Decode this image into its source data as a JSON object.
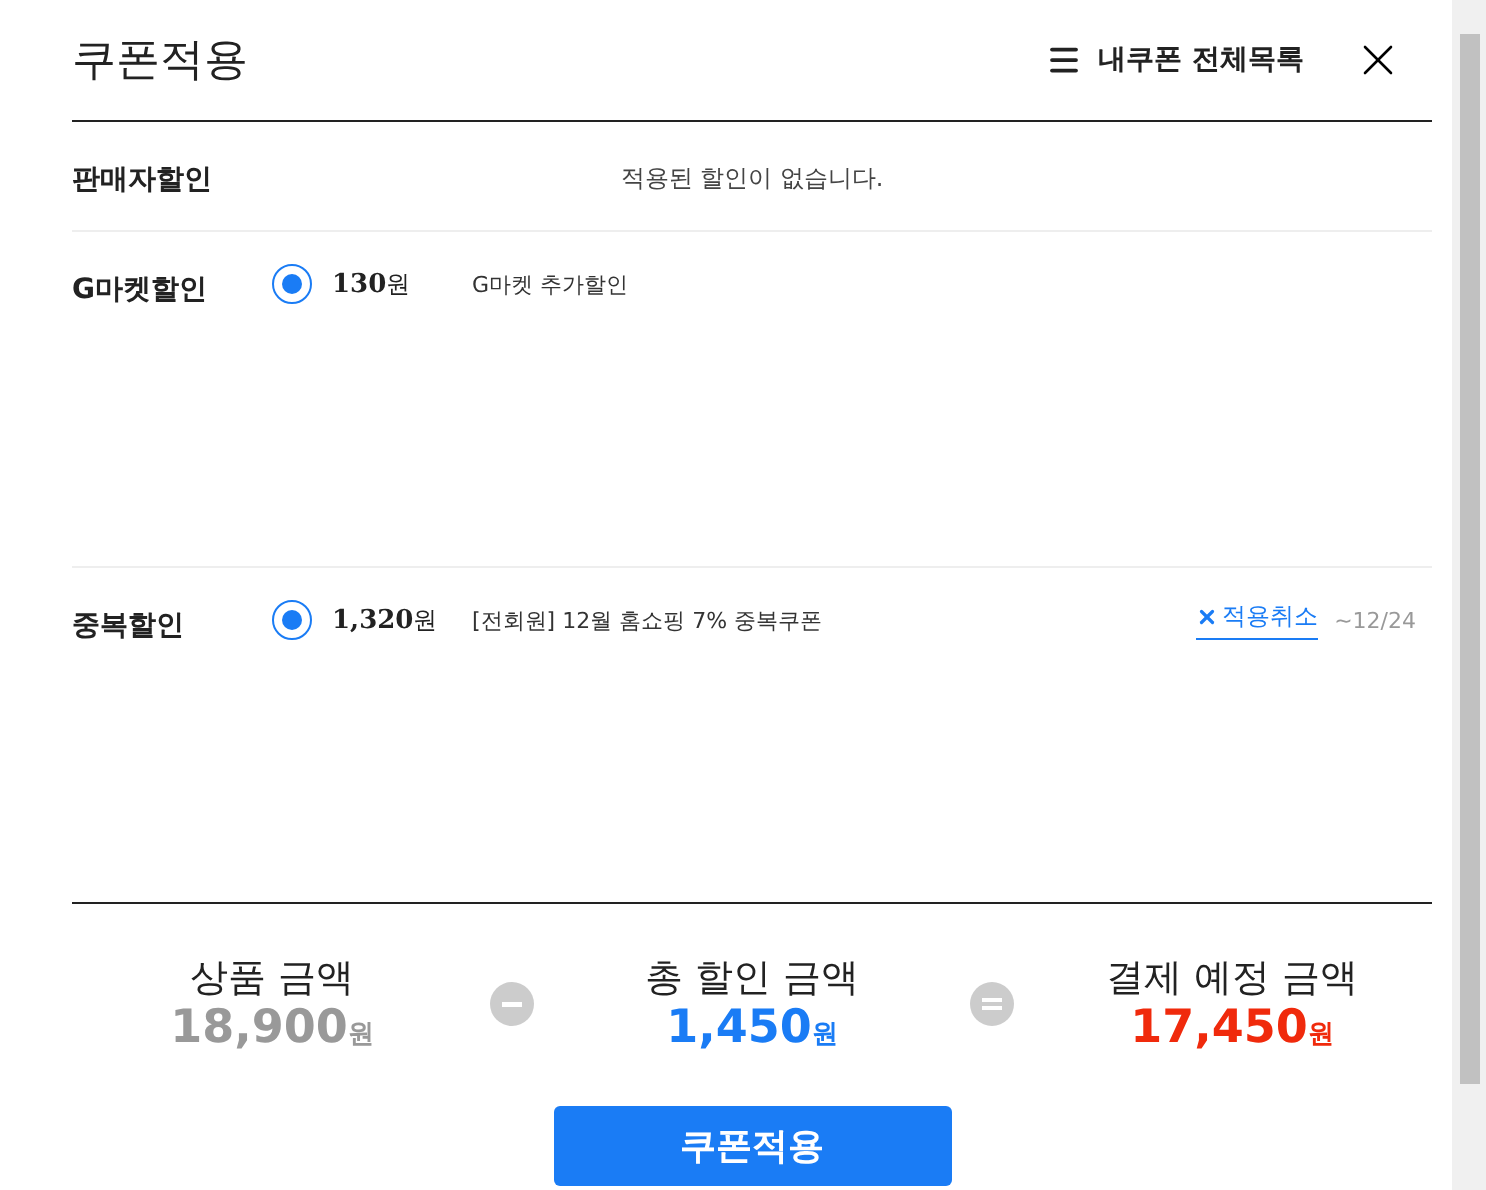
{
  "header": {
    "title": "쿠폰적용",
    "list_link": "내쿠폰 전체목록"
  },
  "sections": [
    {
      "kind": "empty",
      "label": "판매자할인",
      "message": "적용된 할인이 없습니다."
    },
    {
      "kind": "coupon",
      "label": "G마켓할인",
      "coupons": [
        {
          "selected": true,
          "amount": "130",
          "unit": "원",
          "name": "G마켓 추가할인"
        }
      ]
    },
    {
      "kind": "coupon",
      "label": "중복할인",
      "coupons": [
        {
          "selected": true,
          "amount": "1,320",
          "unit": "원",
          "name": "[전회원] 12월 홈쇼핑 7% 중복쿠폰",
          "cancel": "적용취소",
          "expiry": "~12/24"
        }
      ]
    }
  ],
  "summary": [
    {
      "label": "상품 금액",
      "value": "18,900",
      "unit": "원",
      "color": "#999999"
    },
    {
      "label": "총 할인 금액",
      "value": "1,450",
      "unit": "원",
      "color": "#1a7cf5"
    },
    {
      "label": "결제 예정 금액",
      "value": "17,450",
      "unit": "원",
      "color": "#f02a0c"
    }
  ],
  "apply_button": "쿠폰적용"
}
